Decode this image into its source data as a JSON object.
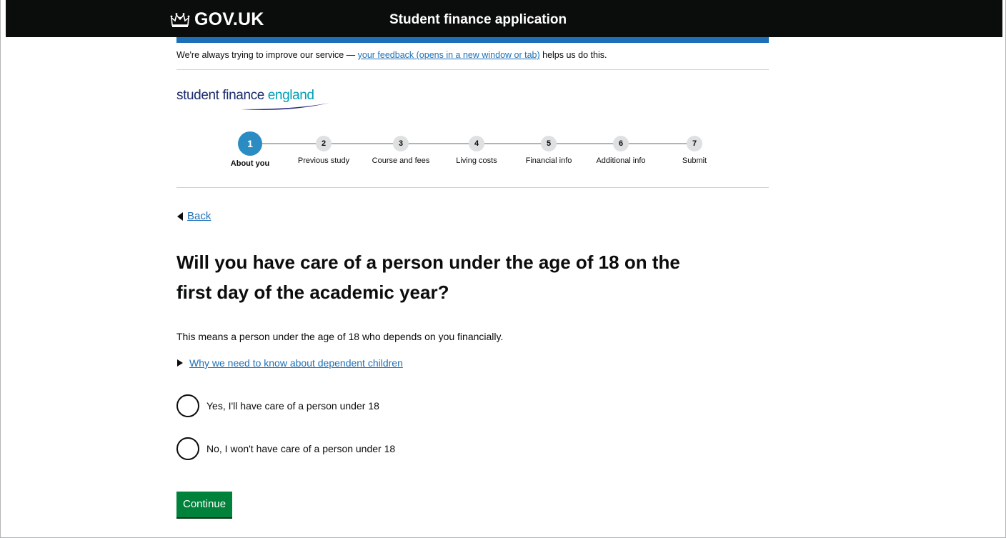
{
  "header": {
    "logo_text": "GOV.UK",
    "service_name": "Student finance application"
  },
  "feedback": {
    "prefix": "We're always trying to improve our service — ",
    "link": "your feedback (opens in a new window or tab)",
    "suffix": " helps us do this."
  },
  "brand": {
    "part1": "student finance ",
    "part2": "england"
  },
  "steps": [
    {
      "number": "1",
      "label": "About you",
      "active": true
    },
    {
      "number": "2",
      "label": "Previous study",
      "active": false
    },
    {
      "number": "3",
      "label": "Course and fees",
      "active": false
    },
    {
      "number": "4",
      "label": "Living costs",
      "active": false
    },
    {
      "number": "5",
      "label": "Financial info",
      "active": false
    },
    {
      "number": "6",
      "label": "Additional info",
      "active": false
    },
    {
      "number": "7",
      "label": "Submit",
      "active": false
    }
  ],
  "back_link": "Back",
  "question": {
    "title": "Will you have care of a person under the age of 18 on the first day of the academic year?",
    "hint": "This means a person under the age of 18 who depends on you financially.",
    "details_link": "Why we need to know about dependent children"
  },
  "options": [
    {
      "label": "Yes, I'll have care of a person under 18",
      "selected": false
    },
    {
      "label": "No, I won't have care of a person under 18",
      "selected": false
    }
  ],
  "continue_label": "Continue",
  "colors": {
    "header_bg": "#0b0c0c",
    "accent_bar": "#1d70b8",
    "link": "#1d70b8",
    "active_step": "#2b8cc4",
    "button": "#00823b"
  }
}
